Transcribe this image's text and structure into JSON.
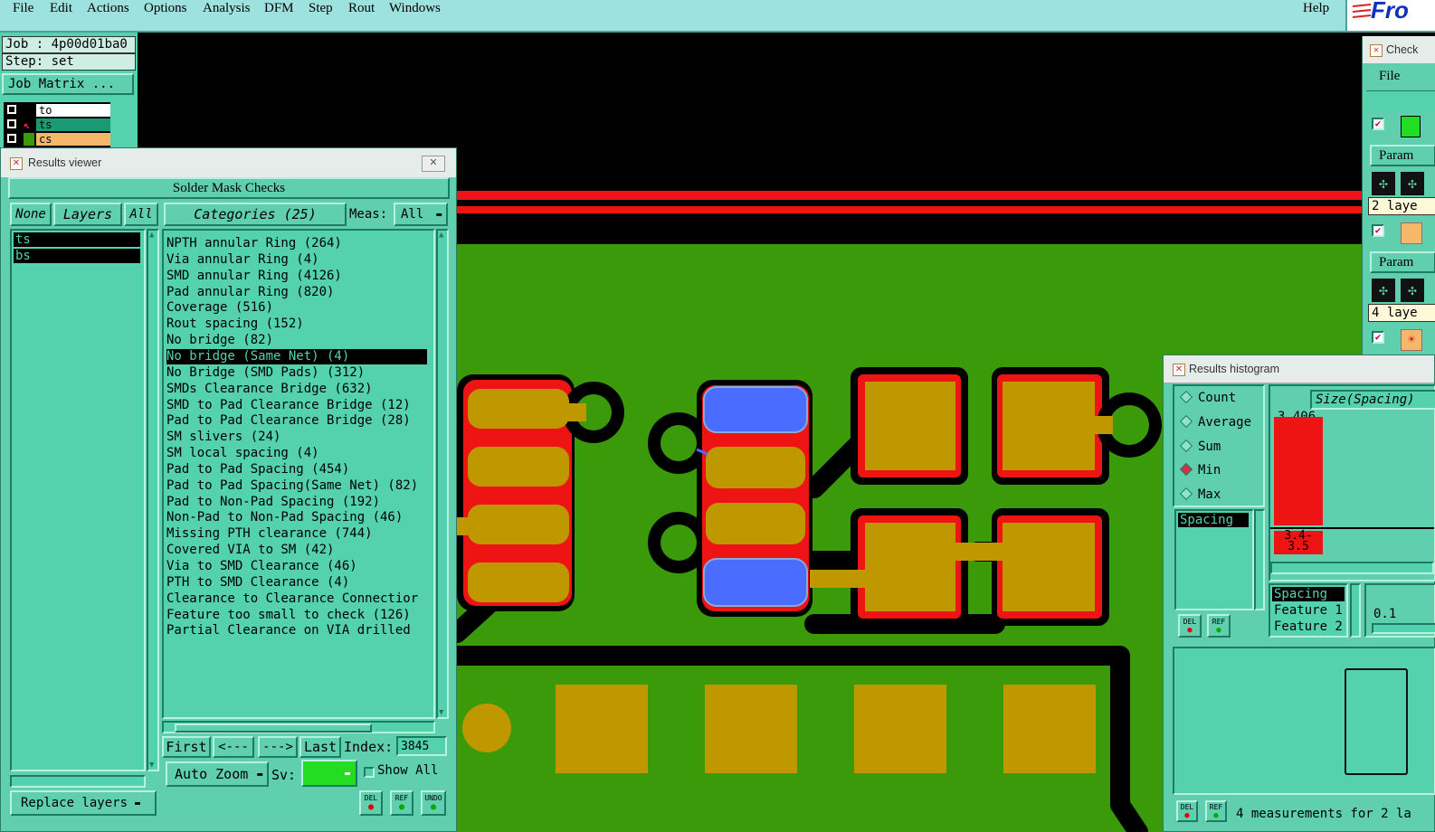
{
  "menubar": {
    "items": [
      "File",
      "Edit",
      "Actions",
      "Options",
      "Analysis",
      "DFM",
      "Step",
      "Rout",
      "Windows"
    ],
    "help": "Help",
    "logo_text": "Fro"
  },
  "job": {
    "job_label": "Job : 4p00d01ba0",
    "step_label": "Step: set",
    "matrix_button": "Job Matrix ...",
    "layers": [
      {
        "name": "to",
        "color": "#ffffff"
      },
      {
        "name": "ts",
        "color": "#1a9a72"
      },
      {
        "name": "cs",
        "color": "#f5b86a"
      }
    ]
  },
  "results_viewer": {
    "window_title": "Results viewer",
    "header": "Solder Mask Checks",
    "layer_buttons": {
      "none": "None",
      "layers": "Layers",
      "all": "All"
    },
    "layers": [
      "ts",
      "bs"
    ],
    "categories_label": "Categories (25)",
    "meas_label": "Meas:",
    "meas_value": "All",
    "categories": [
      "NPTH annular Ring (264)",
      "Via annular Ring (4)",
      "SMD annular Ring (4126)",
      "Pad annular Ring (820)",
      "Coverage (516)",
      "Rout spacing (152)",
      "No bridge (82)",
      "No bridge (Same Net) (4)",
      "No Bridge (SMD Pads) (312)",
      "SMDs Clearance Bridge (632)",
      "SMD to Pad Clearance Bridge (12)",
      "Pad to Pad Clearance Bridge (28)",
      "SM slivers (24)",
      "SM local spacing (4)",
      "Pad to Pad Spacing (454)",
      "Pad to Pad Spacing(Same Net) (82)",
      "Pad to Non-Pad Spacing (192)",
      "Non-Pad to Non-Pad Spacing (46)",
      "Missing PTH clearance (744)",
      "Covered VIA to SM (42)",
      "Via to SMD Clearance (46)",
      "PTH to SMD Clearance (4)",
      "Clearance to Clearance Connectior",
      "Feature too small to check (126)",
      "Partial Clearance on VIA drilled"
    ],
    "selected_category": "No bridge (Same Net) (4)",
    "nav": {
      "first": "First",
      "prev": "<---",
      "next": "--->",
      "last": "Last",
      "index_label": "Index:",
      "index_value": "3845"
    },
    "auto_zoom": "Auto Zoom",
    "sv_label": "Sv:",
    "show_all": "Show All",
    "replace_layers": "Replace layers",
    "icons": [
      "DEL",
      "REF",
      "UNDO"
    ]
  },
  "histogram": {
    "window_title": "Results histogram",
    "modes": [
      "Count",
      "Average",
      "Sum",
      "Min",
      "Max"
    ],
    "selected_mode": "Min",
    "list_item": "Spacing",
    "title": "Size(Spacing)",
    "bar_value": "3.406",
    "bin_label": "3.4-\n3.5",
    "fields": [
      "Spacing",
      "Feature 1",
      "Feature 2"
    ],
    "scale_value": "0.1",
    "status": "4 measurements for 2 la",
    "icons": [
      "DEL",
      "REF"
    ]
  },
  "checklist": {
    "window_title": "Check",
    "file_menu": "File",
    "param_label": "Param",
    "layer_count_1": "2 laye",
    "layer_count_2": "4 laye"
  },
  "colors": {
    "board_green": "#3a9a0a",
    "pad_gold": "#bf9800",
    "mask_red": "#ee1414",
    "highlight_blue": "#4a6cff",
    "panel_teal": "#5fcfae"
  }
}
